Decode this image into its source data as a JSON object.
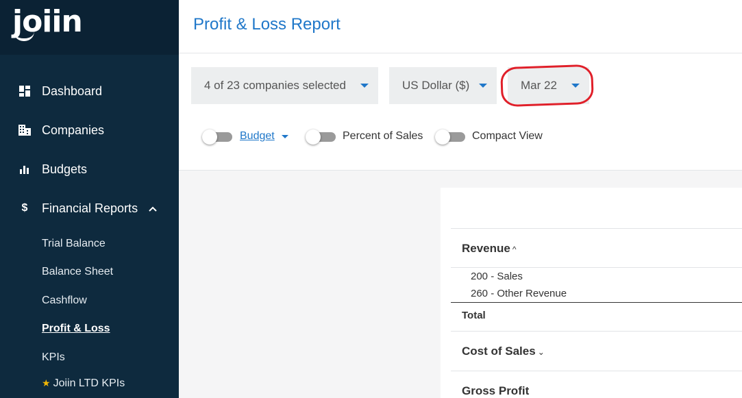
{
  "app": {
    "logo": "joiin"
  },
  "sidebar": {
    "items": [
      {
        "label": "Dashboard",
        "icon": "dashboard-icon"
      },
      {
        "label": "Companies",
        "icon": "building-icon"
      },
      {
        "label": "Budgets",
        "icon": "bar-chart-icon"
      },
      {
        "label": "Financial Reports",
        "icon": "dollar-icon",
        "expanded": true
      }
    ],
    "subitems": [
      {
        "label": "Trial Balance"
      },
      {
        "label": "Balance Sheet"
      },
      {
        "label": "Cashflow"
      },
      {
        "label": "Profit & Loss",
        "active": true
      },
      {
        "label": "KPIs"
      },
      {
        "label": "Joiin LTD KPIs",
        "starred": true
      }
    ]
  },
  "header": {
    "title": "Profit & Loss Report"
  },
  "filters": {
    "companies": "4 of 23 companies selected",
    "currency": "US Dollar ($)",
    "period": "Mar 22",
    "toggles": [
      {
        "label": "Budget",
        "on": false,
        "has_dropdown": true
      },
      {
        "label": "Percent of Sales",
        "on": false
      },
      {
        "label": "Compact View",
        "on": false
      }
    ]
  },
  "report": {
    "revenue": {
      "title": "Revenue",
      "expanded": true,
      "accounts": [
        "200 - Sales",
        "260 - Other Revenue"
      ],
      "total_label": "Total"
    },
    "cost_of_sales": {
      "title": "Cost of Sales",
      "expanded": false
    },
    "gross_profit": {
      "title": "Gross Profit"
    }
  },
  "colors": {
    "sidebar_bg": "#0e2a3e",
    "accent": "#1f77c9",
    "annotation": "#e0202a"
  }
}
